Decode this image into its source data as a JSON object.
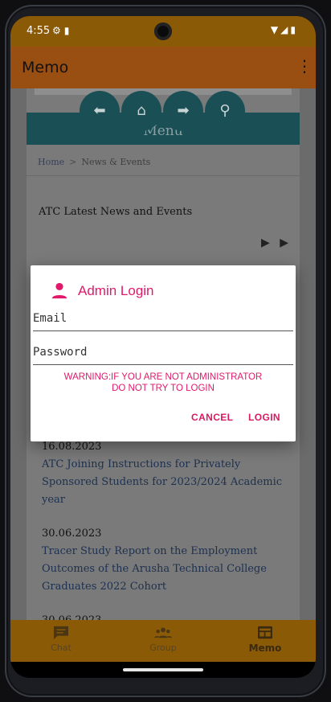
{
  "status_bar": {
    "time": "4:55",
    "left_icons": [
      "settings-gear-icon",
      "sd-card-icon"
    ],
    "right_icons": [
      "wifi-icon",
      "signal-icon",
      "battery-icon"
    ]
  },
  "app_bar": {
    "title": "Memo",
    "menu_icon": "overflow-menu-icon"
  },
  "webpage": {
    "nav_buttons": [
      "back-icon",
      "home-icon",
      "forward-icon",
      "search-icon"
    ],
    "menu_label": "Menu",
    "breadcrumb": {
      "home": "Home",
      "separator": ">",
      "current": "News & Events"
    },
    "section_title": "ATC Latest News and Events",
    "pager_arrows": "▶ ▶",
    "news": [
      {
        "date": "16.08.2023",
        "title": "ATC Joining Instructions for Privately Sponsored Students for 2023/2024 Academic year"
      },
      {
        "date": "30.06.2023",
        "title": "Tracer Study Report on the Employment Outcomes of the Arusha Technical College Graduates 2022 Cohort"
      },
      {
        "date": "30.06.2023",
        "title": ""
      }
    ]
  },
  "dialog": {
    "title": "Admin Login",
    "title_icon": "person-icon",
    "email_placeholder": "Email",
    "password_placeholder": "Password",
    "warning_line1": "WARNING:IF YOU ARE NOT ADMINISTRATOR",
    "warning_line2": "DO NOT TRY TO LOGIN",
    "cancel_label": "CANCEL",
    "login_label": "LOGIN",
    "accent_color": "#e0196a"
  },
  "bottom_nav": {
    "items": [
      {
        "label": "Chat",
        "icon": "chat-icon"
      },
      {
        "label": "Group",
        "icon": "group-icon"
      },
      {
        "label": "Memo",
        "icon": "memo-icon",
        "active": true
      }
    ]
  }
}
